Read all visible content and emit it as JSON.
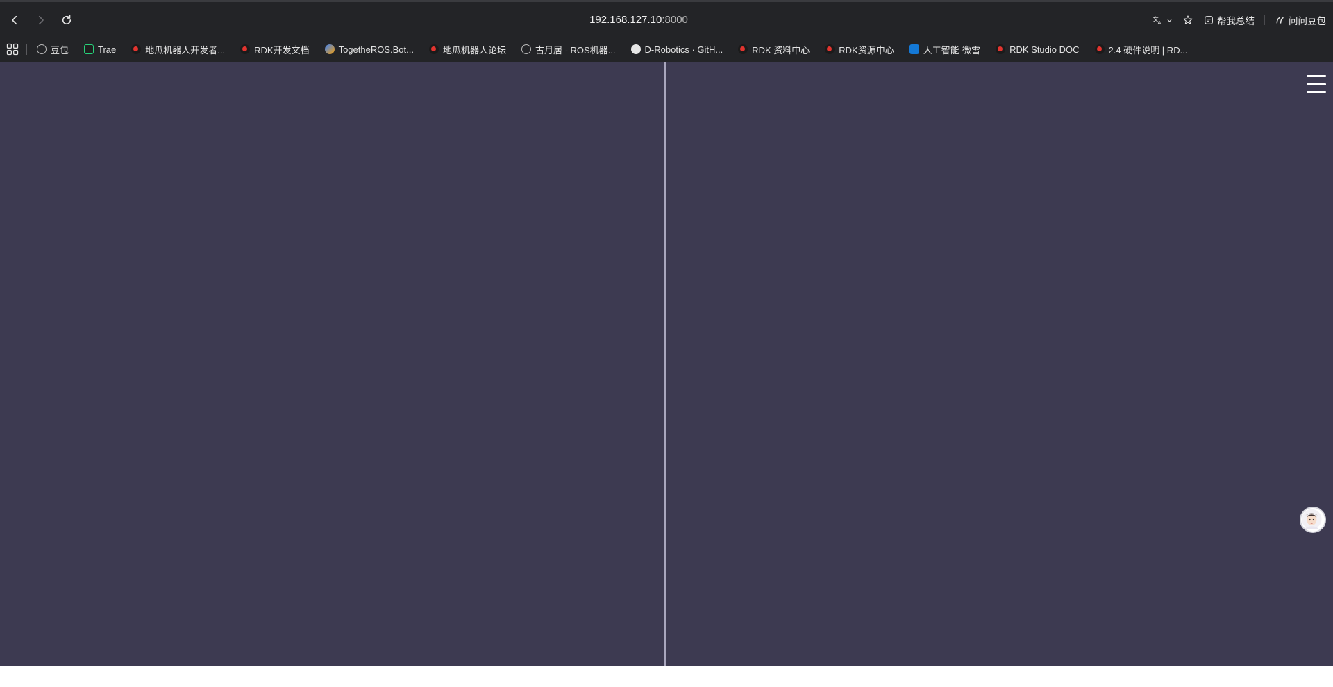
{
  "address": {
    "host": "192.168.127.10",
    "port": ":8000"
  },
  "toolbar": {
    "summary_label": "帮我总结",
    "ask_label": "问问豆包"
  },
  "bookmarks": [
    {
      "label": "豆包",
      "icon": "globe-icon"
    },
    {
      "label": "Trae",
      "icon": "trae-icon"
    },
    {
      "label": "地瓜机器人开发者...",
      "icon": "dgrobot-icon"
    },
    {
      "label": "RDK开发文档",
      "icon": "rdk-icon"
    },
    {
      "label": "TogetheROS.Bot...",
      "icon": "tros-icon"
    },
    {
      "label": "地瓜机器人论坛",
      "icon": "dgrobot-icon"
    },
    {
      "label": "古月居 - ROS机器...",
      "icon": "globe-icon"
    },
    {
      "label": "D-Robotics · GitH...",
      "icon": "github-icon"
    },
    {
      "label": "RDK 资料中心",
      "icon": "rdk-icon"
    },
    {
      "label": "RDK资源中心",
      "icon": "dgrobot-icon"
    },
    {
      "label": "人工智能-微雪",
      "icon": "waveshare-icon"
    },
    {
      "label": "RDK Studio DOC",
      "icon": "rdk-icon"
    },
    {
      "label": "2.4 硬件说明 | RD...",
      "icon": "rdk-icon"
    }
  ],
  "colors": {
    "content_bg": "#3d3a51",
    "divider": "#a9a6bd",
    "toolbar_bg": "#232427"
  }
}
